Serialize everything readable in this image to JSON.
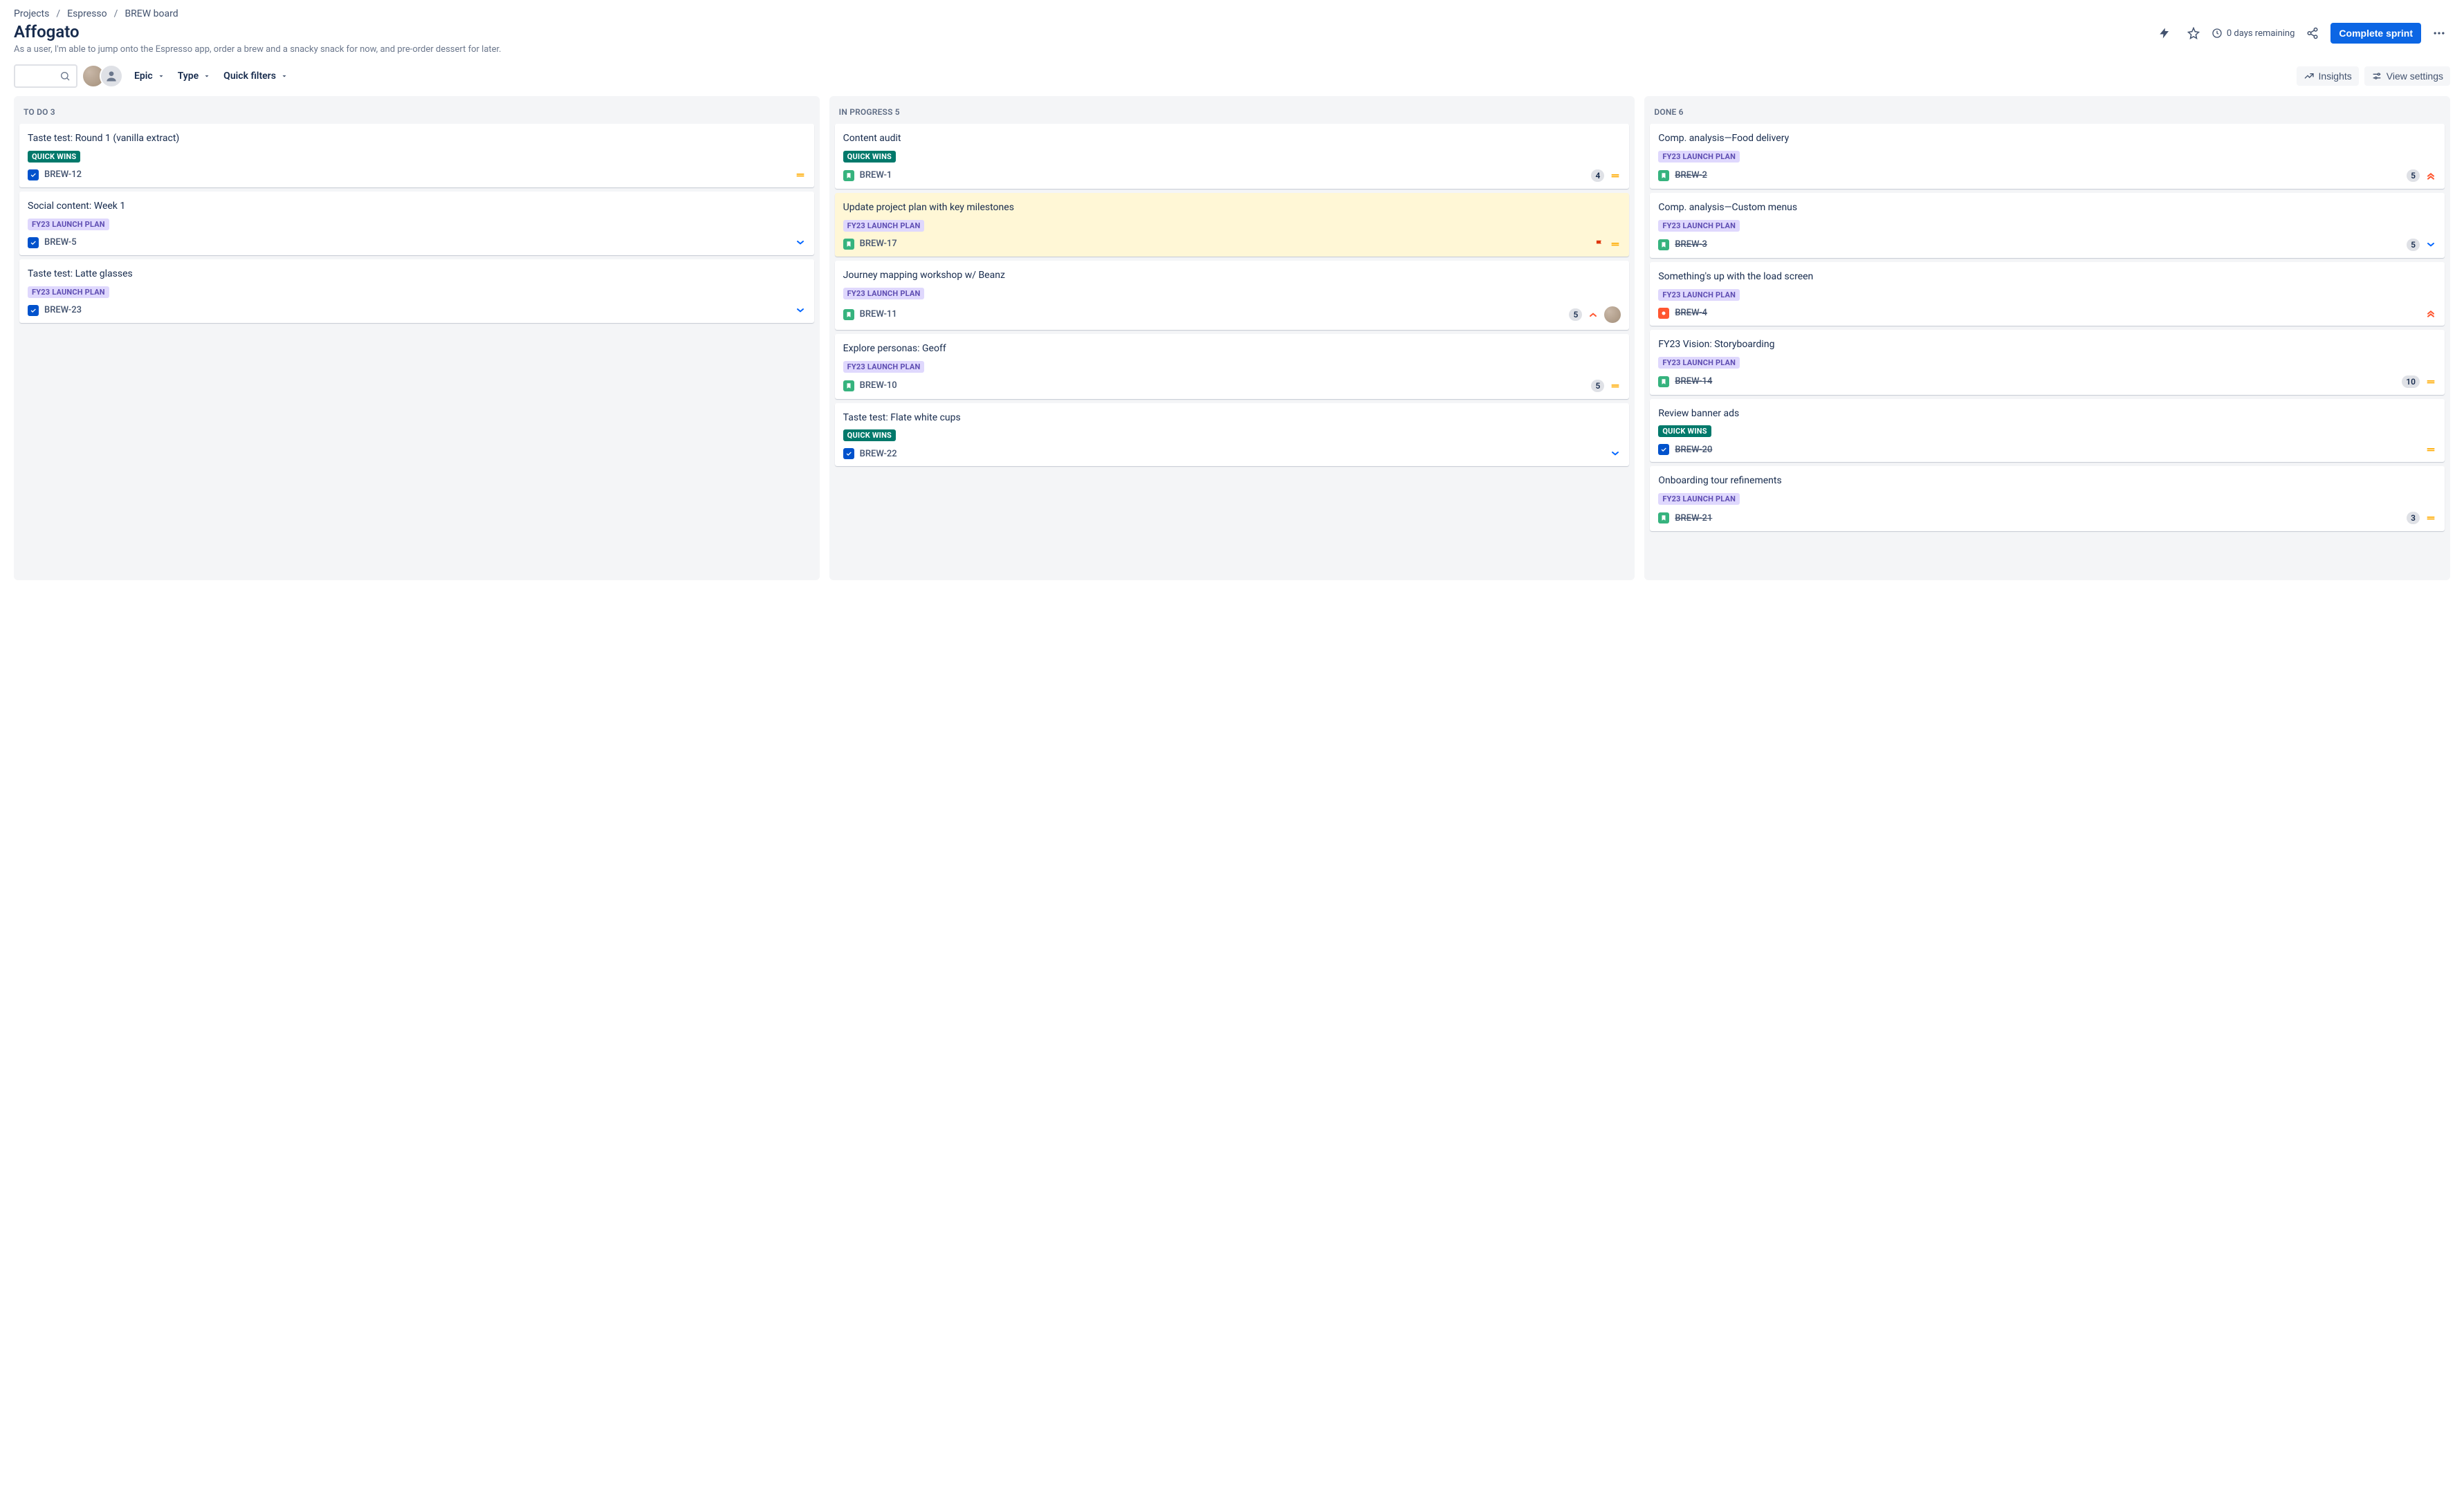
{
  "breadcrumbs": {
    "projects": "Projects",
    "project": "Espresso",
    "board": "BREW board"
  },
  "sprint": {
    "name": "Affogato",
    "goal": "As a user, I'm able to jump onto the Espresso app, order a brew and a snacky snack for now, and pre-order dessert for later.",
    "remaining": "0 days remaining",
    "complete_label": "Complete sprint"
  },
  "filters": {
    "epic": "Epic",
    "type": "Type",
    "quick": "Quick filters"
  },
  "toolbar": {
    "insights": "Insights",
    "view_settings": "View settings"
  },
  "labels": {
    "quick_wins": "QUICK WINS",
    "fy23": "FY23 LAUNCH PLAN"
  },
  "columns": [
    {
      "id": "todo",
      "title": "TO DO",
      "count": "3",
      "cards": [
        {
          "title": "Taste test: Round 1 (vanilla extract)",
          "label": "quick_wins",
          "type": "task",
          "key": "BREW-12",
          "priority": "medium"
        },
        {
          "title": "Social content: Week 1",
          "label": "fy23",
          "type": "task",
          "key": "BREW-5",
          "priority": "low"
        },
        {
          "title": "Taste test: Latte glasses",
          "label": "fy23",
          "type": "task",
          "key": "BREW-23",
          "priority": "low"
        }
      ]
    },
    {
      "id": "inprogress",
      "title": "IN PROGRESS",
      "count": "5",
      "cards": [
        {
          "title": "Content audit",
          "label": "quick_wins",
          "type": "story",
          "key": "BREW-1",
          "sp": "4",
          "priority": "medium"
        },
        {
          "title": "Update project plan with key milestones",
          "label": "fy23",
          "type": "story",
          "key": "BREW-17",
          "flagged": true,
          "priority": "medium"
        },
        {
          "title": "Journey mapping workshop w/ Beanz",
          "label": "fy23",
          "type": "story",
          "key": "BREW-11",
          "sp": "5",
          "priority": "high",
          "assignee": true
        },
        {
          "title": "Explore personas: Geoff",
          "label": "fy23",
          "type": "story",
          "key": "BREW-10",
          "sp": "5",
          "priority": "medium"
        },
        {
          "title": "Taste test: Flate white cups",
          "label": "quick_wins",
          "type": "task",
          "key": "BREW-22",
          "priority": "low"
        }
      ]
    },
    {
      "id": "done",
      "title": "DONE",
      "count": "6",
      "cards": [
        {
          "title": "Comp. analysis—Food delivery",
          "label": "fy23",
          "type": "story",
          "key": "BREW-2",
          "sp": "5",
          "priority": "highest",
          "done": true
        },
        {
          "title": "Comp. analysis—Custom menus",
          "label": "fy23",
          "type": "story",
          "key": "BREW-3",
          "sp": "5",
          "priority": "low",
          "done": true
        },
        {
          "title": "Something's up with the load screen",
          "label": "fy23",
          "type": "bug",
          "key": "BREW-4",
          "priority": "highest",
          "done": true
        },
        {
          "title": "FY23 Vision: Storyboarding",
          "label": "fy23",
          "type": "story",
          "key": "BREW-14",
          "sp": "10",
          "priority": "medium",
          "done": true
        },
        {
          "title": "Review banner ads",
          "label": "quick_wins",
          "type": "task",
          "key": "BREW-20",
          "priority": "medium",
          "done": true
        },
        {
          "title": "Onboarding tour refinements",
          "label": "fy23",
          "type": "story",
          "key": "BREW-21",
          "sp": "3",
          "priority": "medium",
          "done": true
        }
      ]
    }
  ]
}
